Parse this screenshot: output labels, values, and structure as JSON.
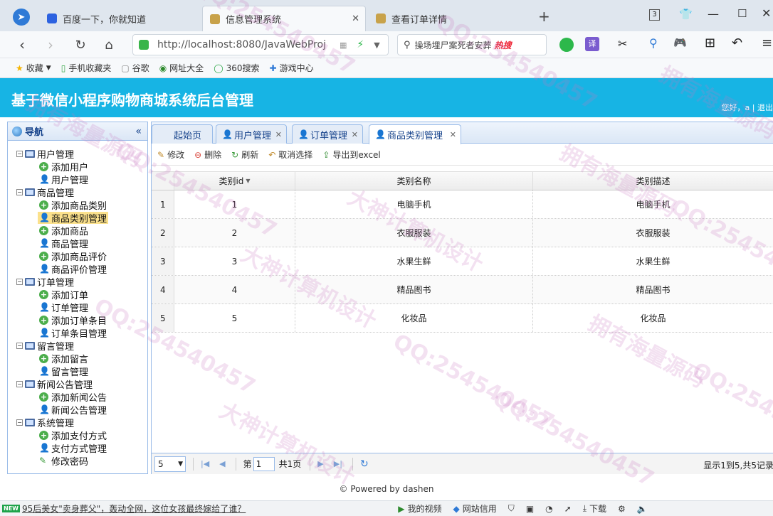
{
  "browser": {
    "tabs": [
      {
        "title": "百度一下，你就知道"
      },
      {
        "title": "信息管理系统"
      },
      {
        "title": "查看订单详情"
      }
    ],
    "tab_count": "3",
    "url": "http://localhost:8080/JavaWebProj",
    "search_text": "操场埋尸案死者安葬",
    "search_hot": "热搜",
    "bookmarks": [
      "收藏",
      "手机收藏夹",
      "谷歌",
      "网址大全",
      "360搜索",
      "游戏中心"
    ]
  },
  "app": {
    "title": "基于微信小程序购物商城系统后台管理",
    "user_greeting": "您好，a | 退出"
  },
  "sidebar": {
    "title": "导航",
    "collapse": "«",
    "groups": [
      {
        "label": "用户管理",
        "items": [
          "添加用户",
          "用户管理"
        ]
      },
      {
        "label": "商品管理",
        "items": [
          "添加商品类别",
          "商品类别管理",
          "添加商品",
          "商品管理",
          "添加商品评价",
          "商品评价管理"
        ]
      },
      {
        "label": "订单管理",
        "items": [
          "添加订单",
          "订单管理",
          "添加订单条目",
          "订单条目管理"
        ]
      },
      {
        "label": "留言管理",
        "items": [
          "添加留言",
          "留言管理"
        ]
      },
      {
        "label": "新闻公告管理",
        "items": [
          "添加新闻公告",
          "新闻公告管理"
        ]
      },
      {
        "label": "系统管理",
        "items": [
          "添加支付方式",
          "支付方式管理",
          "修改密码"
        ]
      }
    ],
    "selected": "商品类别管理"
  },
  "panel_tabs": [
    "起始页",
    "用户管理",
    "订单管理",
    "商品类别管理"
  ],
  "toolbar": [
    "修改",
    "删除",
    "刷新",
    "取消选择",
    "导出到excel"
  ],
  "grid": {
    "columns": [
      "类别id",
      "类别名称",
      "类别描述"
    ],
    "rows": [
      [
        "1",
        "1",
        "电脑手机",
        "电脑手机"
      ],
      [
        "2",
        "2",
        "衣服服装",
        "衣服服装"
      ],
      [
        "3",
        "3",
        "水果生鲜",
        "水果生鲜"
      ],
      [
        "4",
        "4",
        "精品图书",
        "精品图书"
      ],
      [
        "5",
        "5",
        "化妆品",
        "化妆品"
      ]
    ]
  },
  "pager": {
    "page_size": "5",
    "page_prefix": "第",
    "page_value": "1",
    "page_total": "共1页",
    "info": "显示1到5,共5记录"
  },
  "footer": "© Powered by dashen",
  "statusbar": {
    "badge": "NEW",
    "news": "95后美女\"卖身葬父\"，轰动全网，这位女孩最终嫁给了谁？",
    "items": [
      "我的视频",
      "网站信用",
      "下载"
    ]
  },
  "watermarks": [
    "QQ:254540457",
    "大神计算机设计",
    "拥有海量源码"
  ]
}
